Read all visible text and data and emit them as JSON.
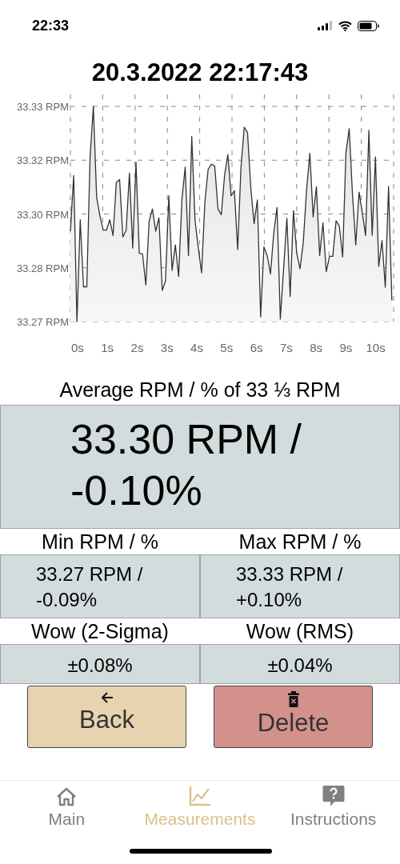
{
  "status_bar": {
    "time": "22:33"
  },
  "title": "20.3.2022 22:17:43",
  "chart": {
    "chart_data": {
      "type": "area",
      "grid": true,
      "x": [
        -0.24,
        -0.13,
        -0.02,
        0.09,
        0.2,
        0.31,
        0.42,
        0.53,
        0.64,
        0.75,
        0.86,
        0.97,
        1.08,
        1.19,
        1.3,
        1.41,
        1.52,
        1.63,
        1.74,
        1.85,
        1.96,
        2.07,
        2.18,
        2.29,
        2.4,
        2.51,
        2.62,
        2.73,
        2.84,
        2.95,
        3.06,
        3.17,
        3.28,
        3.39,
        3.5,
        3.61,
        3.72,
        3.83,
        3.94,
        4.05,
        4.16,
        4.27,
        4.38,
        4.49,
        4.6,
        4.71,
        4.82,
        4.93,
        5.04,
        5.15,
        5.26,
        5.37,
        5.48,
        5.59,
        5.7,
        5.81,
        5.92,
        6.03,
        6.14,
        6.25,
        6.36,
        6.47,
        6.58,
        6.69,
        6.8,
        6.91,
        7.02,
        7.13,
        7.24,
        7.35,
        7.46,
        7.57,
        7.68,
        7.79,
        7.9,
        8.01,
        8.12,
        8.23,
        8.34,
        8.45,
        8.56,
        8.67,
        8.78,
        8.89,
        9.0,
        9.11,
        9.22,
        9.33,
        9.44,
        9.55,
        9.66,
        9.77,
        9.88,
        9.99,
        10.1,
        10.21,
        10.32,
        10.43,
        10.54
      ],
      "series": [
        {
          "color": "#333333",
          "values": [
            33.2952,
            33.3107,
            33.27,
            33.2984,
            33.2797,
            33.2797,
            33.3159,
            33.33,
            33.3047,
            33.2995,
            33.2955,
            33.2955,
            33.2984,
            33.294,
            33.3088,
            33.3096,
            33.2936,
            33.2955,
            33.3114,
            33.2905,
            33.3144,
            33.2891,
            33.2888,
            33.2802,
            33.2979,
            33.3014,
            33.2952,
            33.2989,
            33.2787,
            33.2813,
            33.3051,
            33.2843,
            33.2914,
            33.2826,
            33.304,
            33.3131,
            33.2884,
            33.3216,
            33.2981,
            33.2905,
            33.2836,
            33.3033,
            33.3125,
            33.3139,
            33.3134,
            33.3014,
            33.2998,
            33.3107,
            33.3166,
            33.3051,
            33.3065,
            33.2901,
            33.3129,
            33.3242,
            33.3227,
            33.3073,
            33.2973,
            33.3039,
            33.2713,
            33.2908,
            33.2884,
            33.2833,
            33.2947,
            33.3018,
            33.2707,
            33.2847,
            33.2988,
            33.277,
            33.3009,
            33.2891,
            33.2847,
            33.2921,
            33.3066,
            33.3169,
            33.2992,
            33.3076,
            33.2884,
            33.2975,
            33.2839,
            33.2882,
            33.2882,
            33.2981,
            33.2966,
            33.288,
            33.317,
            33.3238,
            33.3055,
            33.2914,
            33.3061,
            33.3003,
            33.294,
            33.3233,
            33.2941,
            33.3159,
            33.2854,
            33.2926,
            33.2796,
            33.3077,
            33.2759
          ]
        }
      ],
      "xlim": [
        -0.24,
        10.6
      ],
      "ylim": [
        33.27,
        33.33
      ],
      "xticks": [
        {
          "value": 0,
          "label": "0s"
        },
        {
          "value": 1,
          "label": "1s"
        },
        {
          "value": 2,
          "label": "2s"
        },
        {
          "value": 3,
          "label": "3s"
        },
        {
          "value": 4,
          "label": "4s"
        },
        {
          "value": 5,
          "label": "5s"
        },
        {
          "value": 6,
          "label": "6s"
        },
        {
          "value": 7,
          "label": "7s"
        },
        {
          "value": 8,
          "label": "8s"
        },
        {
          "value": 9,
          "label": "9s"
        },
        {
          "value": 10,
          "label": "10s"
        }
      ],
      "yticks": [
        {
          "value": 33.33,
          "label": "33.33 RPM"
        },
        {
          "value": 33.315,
          "label": "33.32 RPM"
        },
        {
          "value": 33.3,
          "label": "33.30 RPM"
        },
        {
          "value": 33.285,
          "label": "33.28 RPM"
        },
        {
          "value": 33.27,
          "label": "33.27 RPM"
        }
      ]
    }
  },
  "average": {
    "label": "Average RPM / % of 33 ⅓ RPM",
    "value": "33.30 RPM / -0.10%"
  },
  "stats": [
    {
      "label": "Min RPM / %",
      "value": "33.27 RPM / -0.09%"
    },
    {
      "label": "Max RPM / %",
      "value": "33.33 RPM / +0.10%"
    },
    {
      "label": "Wow (2-Sigma)",
      "value": "±0.08%"
    },
    {
      "label": "Wow (RMS)",
      "value": "±0.04%"
    }
  ],
  "buttons": [
    {
      "kind": "back",
      "label": "Back"
    },
    {
      "kind": "delete",
      "label": "Delete"
    }
  ],
  "tab_bar": [
    {
      "kind": "home",
      "label": "Main",
      "selected": false
    },
    {
      "kind": "chart",
      "label": "Measurements",
      "selected": true
    },
    {
      "kind": "help",
      "label": "Instructions",
      "selected": false
    }
  ]
}
